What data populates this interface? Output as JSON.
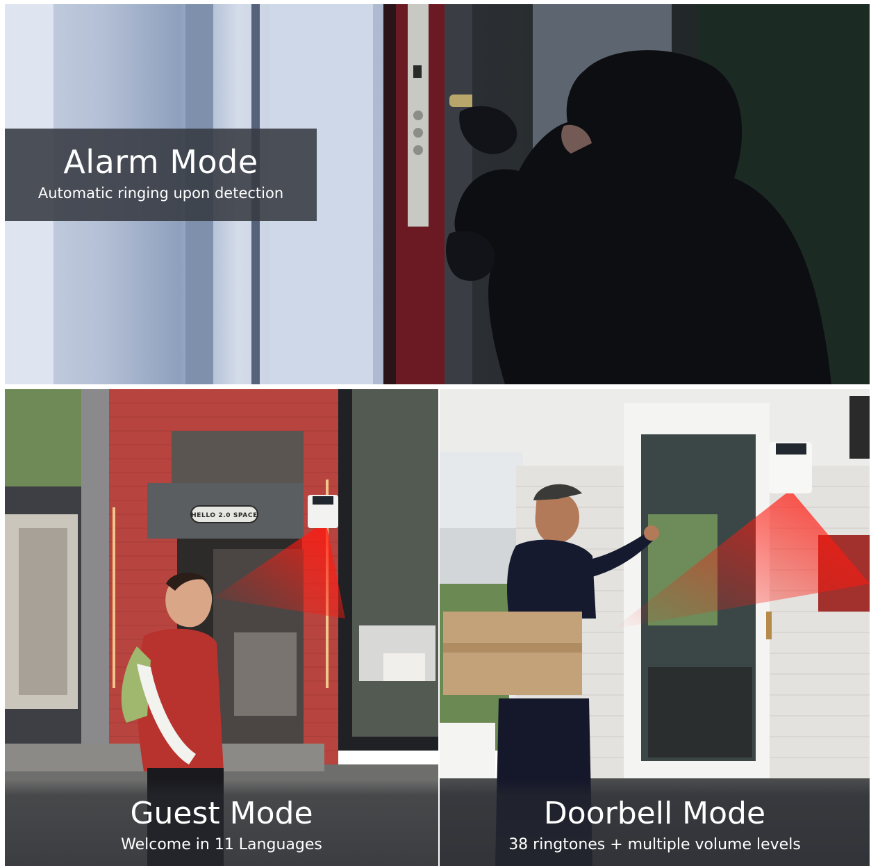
{
  "panels": {
    "alarm": {
      "title": "Alarm Mode",
      "subtitle": "Automatic ringing upon detection"
    },
    "guest": {
      "title": "Guest Mode",
      "subtitle": "Welcome in 11 Languages",
      "sign_text": "HELLO 2.0 SPACE"
    },
    "doorbell": {
      "title": "Doorbell Mode",
      "subtitle": "38 ringtones + multiple volume levels"
    }
  },
  "colors": {
    "caption_background": "#373a42",
    "caption_text": "#ffffff",
    "sensor_beam": "#e0201a",
    "storefront_brick": "#b8443f",
    "door_frame": "#6b1a24"
  },
  "icons": [
    "motion-sensor-icon"
  ]
}
